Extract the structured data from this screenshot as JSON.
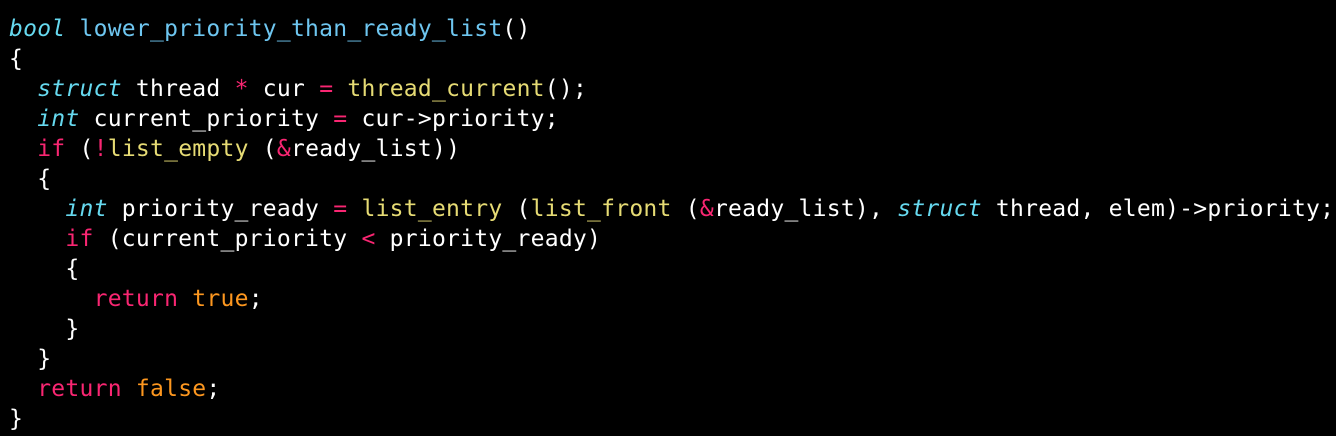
{
  "theme": {
    "background": "#000000",
    "default": "#ffffff",
    "type": "#66d9ef",
    "function_name": "#6ec6f0",
    "call": "#e6db74",
    "keyword": "#f92672",
    "operator": "#f92672",
    "constant": "#fd971f",
    "comment": "#75715e"
  },
  "lines": [
    [
      {
        "t": " */",
        "c": "comment"
      }
    ],
    [
      {
        "t": "bool",
        "c": "type_i"
      },
      {
        "t": " ",
        "c": "default"
      },
      {
        "t": "lower_priority_than_ready_list",
        "c": "function_name"
      },
      {
        "t": "()",
        "c": "default"
      }
    ],
    [
      {
        "t": "{",
        "c": "default"
      }
    ],
    [
      {
        "t": "  ",
        "c": "default"
      },
      {
        "t": "struct",
        "c": "type_i"
      },
      {
        "t": " thread ",
        "c": "default"
      },
      {
        "t": "*",
        "c": "operator"
      },
      {
        "t": " cur ",
        "c": "default"
      },
      {
        "t": "=",
        "c": "operator"
      },
      {
        "t": " ",
        "c": "default"
      },
      {
        "t": "thread_current",
        "c": "call"
      },
      {
        "t": "();",
        "c": "default"
      }
    ],
    [
      {
        "t": "  ",
        "c": "default"
      },
      {
        "t": "int",
        "c": "type_i"
      },
      {
        "t": " current_priority ",
        "c": "default"
      },
      {
        "t": "=",
        "c": "operator"
      },
      {
        "t": " cur->priority;",
        "c": "default"
      }
    ],
    [
      {
        "t": "  ",
        "c": "default"
      },
      {
        "t": "if",
        "c": "keyword"
      },
      {
        "t": " (",
        "c": "default"
      },
      {
        "t": "!",
        "c": "operator"
      },
      {
        "t": "list_empty",
        "c": "call"
      },
      {
        "t": " (",
        "c": "default"
      },
      {
        "t": "&",
        "c": "operator"
      },
      {
        "t": "ready_list))",
        "c": "default"
      }
    ],
    [
      {
        "t": "  {",
        "c": "default"
      }
    ],
    [
      {
        "t": "    ",
        "c": "default"
      },
      {
        "t": "int",
        "c": "type_i"
      },
      {
        "t": " priority_ready ",
        "c": "default"
      },
      {
        "t": "=",
        "c": "operator"
      },
      {
        "t": " ",
        "c": "default"
      },
      {
        "t": "list_entry",
        "c": "call"
      },
      {
        "t": " (",
        "c": "default"
      },
      {
        "t": "list_front",
        "c": "call"
      },
      {
        "t": " (",
        "c": "default"
      },
      {
        "t": "&",
        "c": "operator"
      },
      {
        "t": "ready_list), ",
        "c": "default"
      },
      {
        "t": "struct",
        "c": "type_i"
      },
      {
        "t": " thread, elem)->priority;",
        "c": "default"
      }
    ],
    [
      {
        "t": "    ",
        "c": "default"
      },
      {
        "t": "if",
        "c": "keyword"
      },
      {
        "t": " (current_priority ",
        "c": "default"
      },
      {
        "t": "<",
        "c": "operator"
      },
      {
        "t": " priority_ready)",
        "c": "default"
      }
    ],
    [
      {
        "t": "    {",
        "c": "default"
      }
    ],
    [
      {
        "t": "      ",
        "c": "default"
      },
      {
        "t": "return",
        "c": "keyword"
      },
      {
        "t": " ",
        "c": "default"
      },
      {
        "t": "true",
        "c": "constant"
      },
      {
        "t": ";",
        "c": "default"
      }
    ],
    [
      {
        "t": "    }",
        "c": "default"
      }
    ],
    [
      {
        "t": "  }",
        "c": "default"
      }
    ],
    [
      {
        "t": "  ",
        "c": "default"
      },
      {
        "t": "return",
        "c": "keyword"
      },
      {
        "t": " ",
        "c": "default"
      },
      {
        "t": "false",
        "c": "constant"
      },
      {
        "t": ";",
        "c": "default"
      }
    ],
    [
      {
        "t": "}",
        "c": "default"
      }
    ]
  ]
}
